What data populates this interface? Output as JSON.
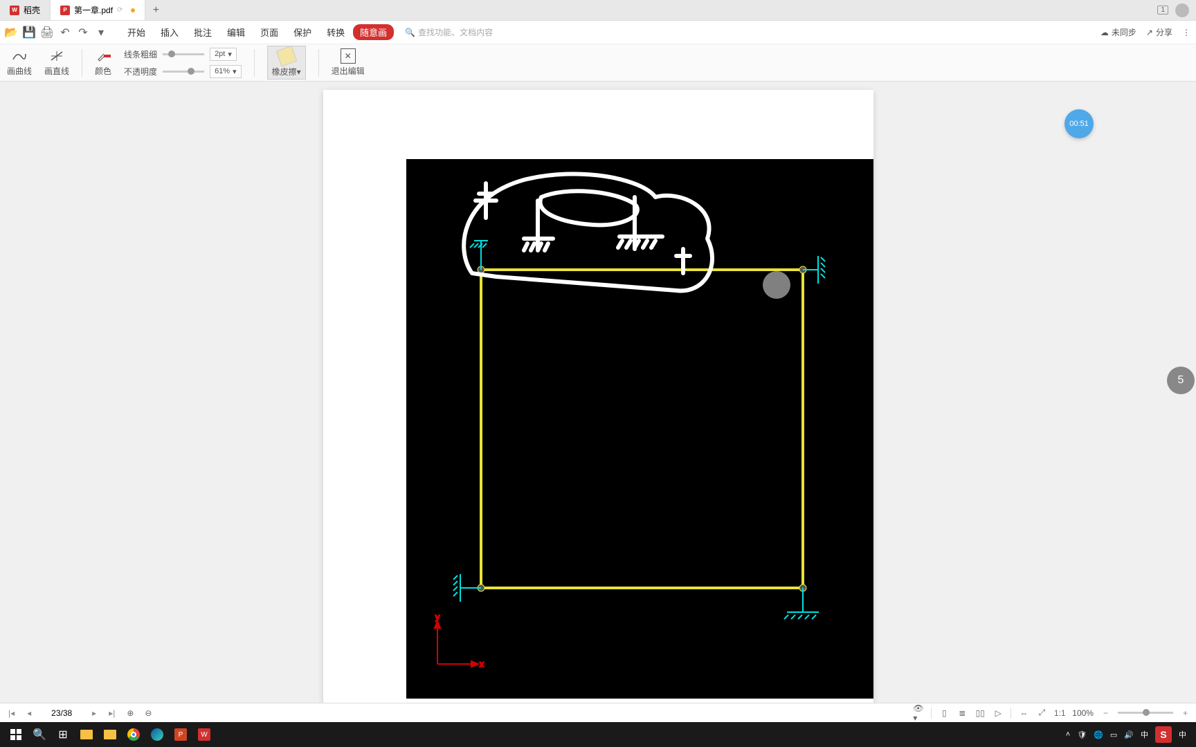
{
  "tabs": {
    "tab1": "稻壳",
    "tab2": "第一章.pdf"
  },
  "menubar": {
    "start": "开始",
    "insert": "插入",
    "annotate": "批注",
    "edit": "编辑",
    "page": "页面",
    "protect": "保护",
    "convert": "转换",
    "draw": "随意画",
    "search_placeholder": "查找功能、文档内容",
    "not_synced": "未同步",
    "share": "分享"
  },
  "toolbar": {
    "curve": "画曲线",
    "line": "画直线",
    "color": "颜色",
    "stroke_label": "线条粗细",
    "opacity_label": "不透明度",
    "stroke_value": "2pt",
    "opacity_value": "61%",
    "eraser": "橡皮擦",
    "exit": "退出编辑"
  },
  "recorder": {
    "time": "00:51"
  },
  "float": {
    "label": "5"
  },
  "status": {
    "page": "23/38",
    "zoom": "100%"
  },
  "tabbar_right": {
    "count": "1"
  },
  "chart_data": {
    "type": "diagram",
    "description": "Structural engineering frame on black background: yellow rectangular frame with supports",
    "frame": {
      "shape": "rectangle",
      "color": "#e8e337",
      "nodes": 4
    },
    "supports": [
      {
        "position": "top-left",
        "type": "fixed-lateral",
        "color": "#00e0e0"
      },
      {
        "position": "top-right",
        "type": "fixed-lateral",
        "color": "#00e0e0"
      },
      {
        "position": "bottom-left",
        "type": "fixed-lateral",
        "color": "#00e0e0"
      },
      {
        "position": "bottom-right",
        "type": "pinned-ground",
        "color": "#00e0e0"
      }
    ],
    "axes": {
      "x_label": "x",
      "y_label": "y",
      "color": "#d40000",
      "arrows": true
    },
    "annotations": {
      "eraser_preview": {
        "shape": "circle",
        "fill": "#808080",
        "position": "upper-right of frame"
      },
      "freehand_scribble": {
        "color": "#ffffff",
        "area": "above top beam, large irregular loop with hatched load symbols"
      }
    }
  }
}
